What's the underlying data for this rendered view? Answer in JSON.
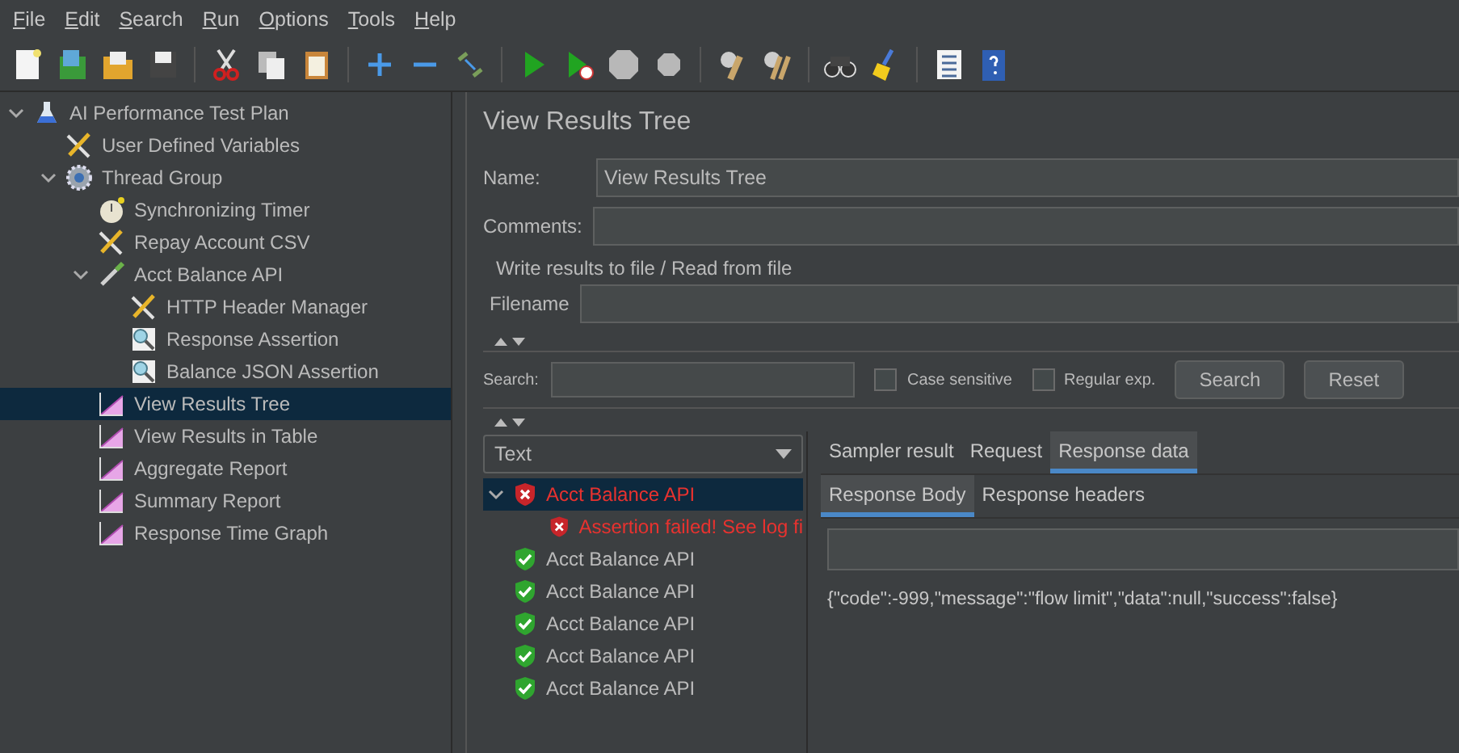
{
  "menu": [
    "File",
    "Edit",
    "Search",
    "Run",
    "Options",
    "Tools",
    "Help"
  ],
  "tree": [
    {
      "label": "AI Performance Test Plan",
      "kind": "test-plan",
      "expanded": true,
      "selected": false,
      "children": [
        {
          "label": "User Defined Variables",
          "kind": "config",
          "selected": false
        },
        {
          "label": "Thread Group",
          "kind": "thread-group",
          "expanded": true,
          "selected": false,
          "children": [
            {
              "label": "Synchronizing Timer",
              "kind": "timer",
              "selected": false
            },
            {
              "label": "Repay Account CSV",
              "kind": "config",
              "selected": false
            },
            {
              "label": "Acct Balance API",
              "kind": "sampler",
              "expanded": true,
              "selected": false,
              "children": [
                {
                  "label": "HTTP Header Manager",
                  "kind": "config",
                  "selected": false
                },
                {
                  "label": "Response Assertion",
                  "kind": "assertion",
                  "selected": false
                },
                {
                  "label": "Balance JSON Assertion",
                  "kind": "assertion",
                  "selected": false
                }
              ]
            },
            {
              "label": "View Results Tree",
              "kind": "listener",
              "selected": true
            },
            {
              "label": "View Results in Table",
              "kind": "listener",
              "selected": false
            },
            {
              "label": "Aggregate Report",
              "kind": "listener",
              "selected": false
            },
            {
              "label": "Summary Report",
              "kind": "listener",
              "selected": false
            },
            {
              "label": "Response Time Graph",
              "kind": "listener",
              "selected": false
            }
          ]
        }
      ]
    }
  ],
  "panel": {
    "title": "View Results Tree",
    "name_label": "Name:",
    "name_value": "View Results Tree",
    "comments_label": "Comments:",
    "file_group": "Write results to file / Read from file",
    "filename_label": "Filename",
    "search_label": "Search:",
    "options": [
      {
        "label": "Case sensitive",
        "checked": false
      },
      {
        "label": "Regular exp.",
        "checked": false
      }
    ],
    "buttons": [
      "Search",
      "Reset"
    ]
  },
  "renderer": "Text",
  "results": [
    {
      "label": "Acct Balance API",
      "failed": true,
      "expanded": true,
      "selected": true,
      "children": [
        {
          "label": "Assertion failed! See log fi",
          "failed": true,
          "selected": false
        }
      ]
    },
    {
      "label": "Acct Balance API",
      "failed": false,
      "selected": false
    },
    {
      "label": "Acct Balance API",
      "failed": false,
      "selected": false
    },
    {
      "label": "Acct Balance API",
      "failed": false,
      "selected": false
    },
    {
      "label": "Acct Balance API",
      "failed": false,
      "selected": false
    },
    {
      "label": "Acct Balance API",
      "failed": false,
      "selected": false
    }
  ],
  "result_tabs": [
    {
      "label": "Sampler result",
      "selected": false
    },
    {
      "label": "Request",
      "selected": false
    },
    {
      "label": "Response data",
      "selected": true
    }
  ],
  "body_tabs": [
    {
      "label": "Response Body",
      "selected": true
    },
    {
      "label": "Response headers",
      "selected": false
    }
  ],
  "response_text": "{\"code\":-999,\"message\":\"flow limit\",\"data\":null,\"success\":false}"
}
